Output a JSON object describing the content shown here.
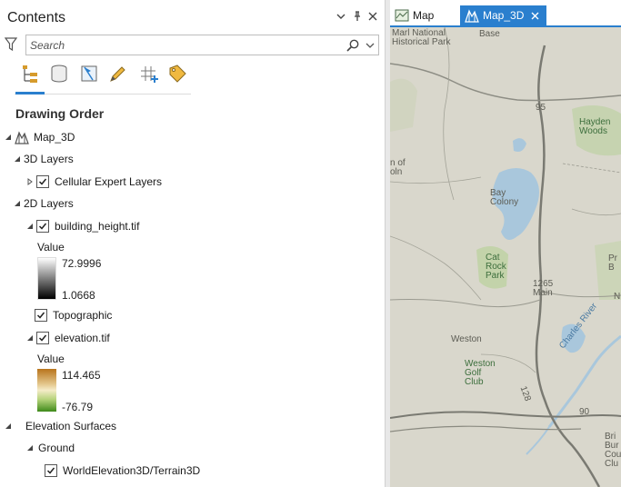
{
  "pane": {
    "title": "Contents",
    "search_placeholder": "Search",
    "section_title": "Drawing Order"
  },
  "toolbar": {
    "icons": [
      "list-by-drawing-order-icon",
      "list-by-source-icon",
      "list-by-selection-icon",
      "list-by-editing-icon",
      "list-by-snapping-icon",
      "list-by-labeling-icon"
    ]
  },
  "tree": {
    "map_name": "Map_3D",
    "group_3d": "3D Layers",
    "cellular": "Cellular Expert Layers",
    "group_2d": "2D Layers",
    "building": "building_height.tif",
    "building_legend_title": "Value",
    "building_max": "72.9996",
    "building_min": "1.0668",
    "topographic": "Topographic",
    "elevation": "elevation.tif",
    "elevation_legend_title": "Value",
    "elevation_max": "114.465",
    "elevation_min": "-76.79",
    "elevation_surfaces": "Elevation Surfaces",
    "ground": "Ground",
    "terrain": "WorldElevation3D/Terrain3D"
  },
  "tabs": [
    {
      "label": "Map",
      "active": false
    },
    {
      "label": "Map_3D",
      "active": true
    }
  ],
  "map": {
    "labels": {
      "marl": "Marl National\nHistorical Park",
      "base": "Base",
      "hayden": "Hayden\nWoods",
      "bay": "Bay\nColony",
      "cat": "Cat\nRock\nPark",
      "main": "1265\nMain",
      "weston": "Weston",
      "weston_golf": "Weston\nGolf\nClub",
      "charles": "Charles River",
      "ofoln": "n of\noln",
      "pr": "Pr\nB",
      "bri": "Bri\nBur\nCour\nClu",
      "r90": "90",
      "r95": "95",
      "r128": "128",
      "n": "N"
    }
  },
  "colors": {
    "accent": "#2a7fce",
    "map_bg": "#d9d7cc",
    "water": "#a9c7dc",
    "park": "#c3d3aa"
  }
}
